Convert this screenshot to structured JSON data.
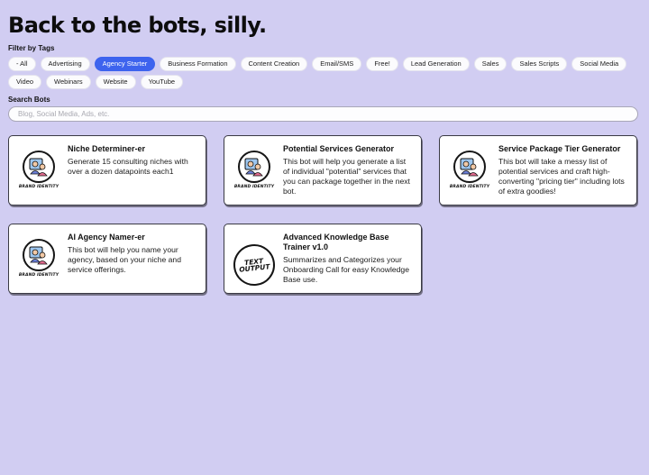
{
  "header": {
    "title": "Back to the bots, silly."
  },
  "filters": {
    "label": "Filter by Tags",
    "tags": [
      {
        "label": "- All",
        "active": false
      },
      {
        "label": "Advertising",
        "active": false
      },
      {
        "label": "Agency Starter",
        "active": true
      },
      {
        "label": "Business Formation",
        "active": false
      },
      {
        "label": "Content Creation",
        "active": false
      },
      {
        "label": "Email/SMS",
        "active": false
      },
      {
        "label": "Free!",
        "active": false
      },
      {
        "label": "Lead Generation",
        "active": false
      },
      {
        "label": "Sales",
        "active": false
      },
      {
        "label": "Sales Scripts",
        "active": false
      },
      {
        "label": "Social Media",
        "active": false
      },
      {
        "label": "Video",
        "active": false
      },
      {
        "label": "Webinars",
        "active": false
      },
      {
        "label": "Website",
        "active": false
      },
      {
        "label": "YouTube",
        "active": false
      }
    ]
  },
  "search": {
    "label": "Search Bots",
    "placeholder": "Blog, Social Media, Ads, etc.",
    "value": ""
  },
  "bots": [
    {
      "title": "Niche Determiner-er",
      "description": "Generate 15 consulting niches with over a dozen datapoints each1",
      "thumbnail": {
        "type": "brand-identity-icon",
        "caption": "BRAND IDENTITY"
      }
    },
    {
      "title": "Potential Services Generator",
      "description": "This bot will help you generate a list of individual \"potential\" services that you can package together in the next bot.",
      "thumbnail": {
        "type": "brand-identity-icon",
        "caption": "BRAND IDENTITY"
      }
    },
    {
      "title": "Service Package Tier Generator",
      "description": "This bot will take a messy list of potential services and craft high-converting \"pricing tier\" including lots of extra goodies!",
      "thumbnail": {
        "type": "brand-identity-icon",
        "caption": "BRAND IDENTITY"
      }
    },
    {
      "title": "AI Agency Namer-er",
      "description": "This bot will help you name your agency, based on your niche and service offerings.",
      "thumbnail": {
        "type": "brand-identity-icon",
        "caption": "BRAND IDENTITY"
      }
    },
    {
      "title": "Advanced Knowledge Base Trainer v1.0",
      "description": "Summarizes and Categorizes your Onboarding Call for easy Knowledge Base use.",
      "thumbnail": {
        "type": "text-output-icon",
        "caption": "TEXT OUTPUT"
      }
    }
  ],
  "colors": {
    "background": "#d1cdf2",
    "active_tag": "#3d63ee",
    "card_border": "#3a3a44"
  }
}
